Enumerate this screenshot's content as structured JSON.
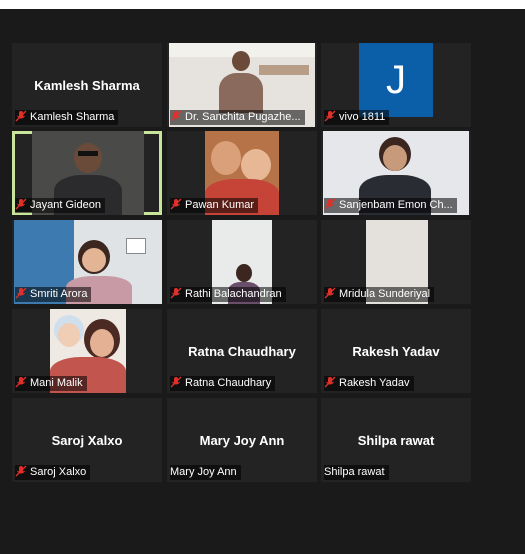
{
  "participants": [
    {
      "name": "Kamlesh Sharma",
      "display_name": "Kamlesh Sharma",
      "muted": true
    },
    {
      "name": "Dr. Sanchita Pugazhe...",
      "muted": true
    },
    {
      "name": "vivo 1811",
      "avatar_letter": "J",
      "muted": true
    },
    {
      "name": "Jayant Gideon",
      "muted": true,
      "active": true
    },
    {
      "name": "Pawan Kumar",
      "muted": true
    },
    {
      "name": "Sanjenbam Emon Ch...",
      "muted": true
    },
    {
      "name": "Smriti Arora",
      "muted": true
    },
    {
      "name": "Rathi Balachandran",
      "muted": true
    },
    {
      "name": "Mridula Sunderiyal",
      "muted": true
    },
    {
      "name": "Mani Malik",
      "muted": true
    },
    {
      "name": "Ratna Chaudhary",
      "display_name": "Ratna Chaudhary",
      "muted": true
    },
    {
      "name": "Rakesh Yadav",
      "display_name": "Rakesh Yadav",
      "muted": true
    },
    {
      "name": "Saroj Xalxo",
      "display_name": "Saroj Xalxo",
      "muted": true
    },
    {
      "name": "Mary Joy Ann",
      "display_name": "Mary Joy Ann",
      "muted": false
    },
    {
      "name": "Shilpa rawat",
      "display_name": "Shilpa rawat",
      "muted": false
    }
  ],
  "colors": {
    "active_border": "#c9e59a",
    "muted_icon": "#e0302b",
    "tile_bg": "#232323",
    "avatar_bg": "#0b5fa8"
  }
}
